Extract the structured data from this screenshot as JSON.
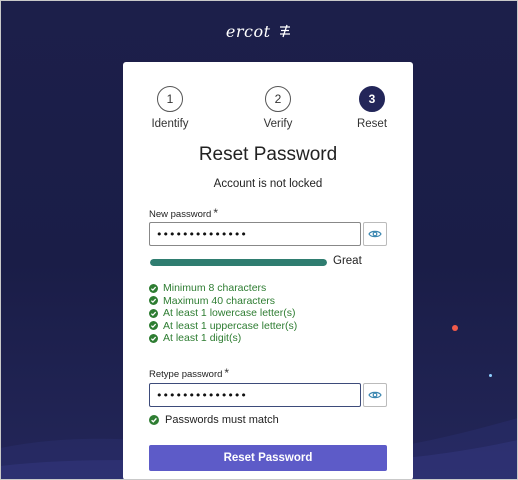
{
  "brand": {
    "name": "ercot"
  },
  "steps": [
    {
      "number": "1",
      "label": "Identify"
    },
    {
      "number": "2",
      "label": "Verify"
    },
    {
      "number": "3",
      "label": "Reset"
    }
  ],
  "form": {
    "title": "Reset Password",
    "subtitle": "Account is not locked",
    "new_password": {
      "label": "New password",
      "required_mark": "*",
      "value": "••••••••••••••"
    },
    "strength": {
      "label": "Great",
      "level": 1.0,
      "color": "#2f7d70"
    },
    "requirements": [
      {
        "label": "Minimum 8 characters",
        "met": true
      },
      {
        "label": "Maximum 40 characters",
        "met": true
      },
      {
        "label": "At least 1 lowercase letter(s)",
        "met": true
      },
      {
        "label": "At least 1 uppercase letter(s)",
        "met": true
      },
      {
        "label": "At least 1 digit(s)",
        "met": true
      }
    ],
    "retype_password": {
      "label": "Retype password",
      "required_mark": "*",
      "value": "••••••••••••••"
    },
    "match_message": "Passwords must match",
    "submit_label": "Reset Password"
  },
  "icons": {
    "eye": "eye-icon",
    "check": "check-circle-icon"
  },
  "colors": {
    "background": "#1c1f4a",
    "active_step": "#232659",
    "button": "#5d5bc8",
    "success": "#2e7d32",
    "dot_red": "#f25a4a",
    "dot_blue": "#8fd0ff"
  }
}
